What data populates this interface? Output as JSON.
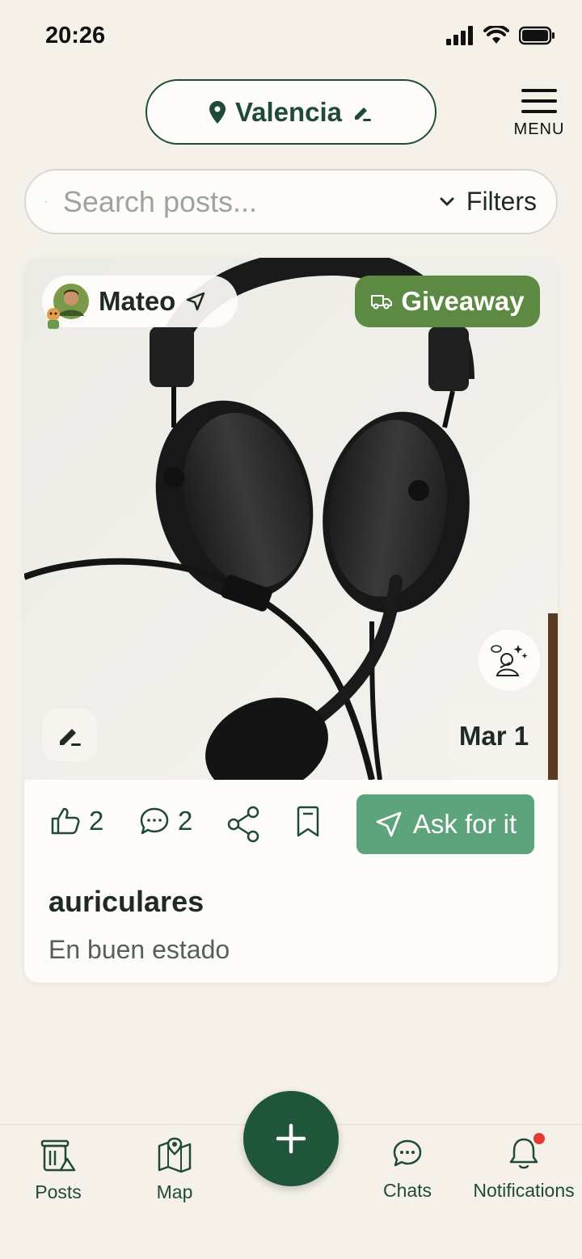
{
  "status_bar": {
    "time": "20:26"
  },
  "header": {
    "location": "Valencia",
    "menu_label": "MENU"
  },
  "search": {
    "placeholder": "Search posts...",
    "filters_label": "Filters"
  },
  "post": {
    "user_name": "Mateo",
    "badge": "Giveaway",
    "date": "Mar 1",
    "likes": "2",
    "comments": "2",
    "ask_label": "Ask for it",
    "title": "auriculares",
    "description": "En buen estado"
  },
  "nav": {
    "items": [
      {
        "label": "Posts",
        "icon": "posts-icon"
      },
      {
        "label": "Map",
        "icon": "map-icon"
      },
      {
        "label": "Chats",
        "icon": "chat-icon"
      },
      {
        "label": "Notifications",
        "icon": "bell-icon"
      }
    ]
  },
  "colors": {
    "background": "#f5f1e8",
    "primary_green": "#1f4a36",
    "giveaway_green": "#5d8a43",
    "ask_green": "#5da37b",
    "fab_green": "#1f5538",
    "notification_dot": "#e53935"
  }
}
